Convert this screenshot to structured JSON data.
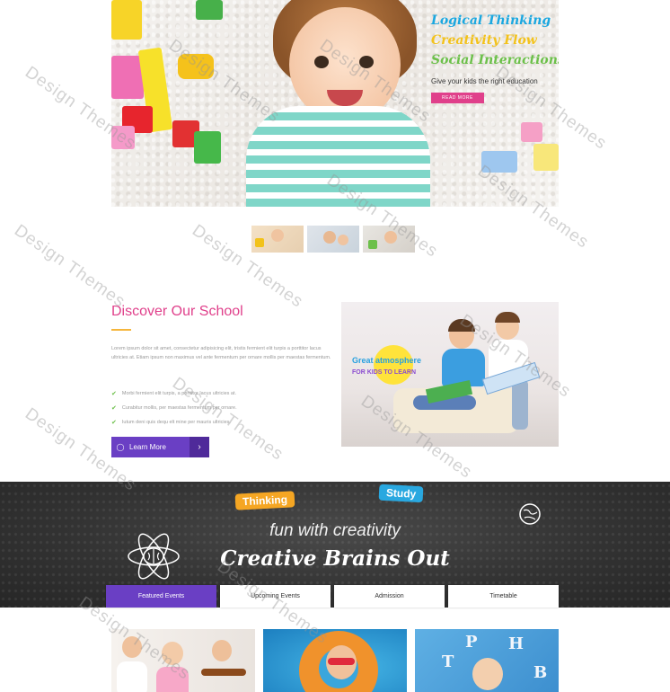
{
  "hero": {
    "line1": "Logical Thinking",
    "line2": "Creativity Flow",
    "line3": "Social Interactions",
    "tagline": "Give your kids the right education",
    "button_label": "READ MORE",
    "accent_colors": {
      "line1": "#1aa7e0",
      "line2": "#f3c21b",
      "line3": "#6cc04a",
      "button": "#e0408b"
    }
  },
  "slider": {
    "thumbnails": [
      "hero-slide-1",
      "hero-slide-2",
      "hero-slide-3"
    ]
  },
  "discover": {
    "title": "Discover Our School",
    "paragraph": "Lorem ipsum dolor sit amet, consectetur adipisicing elit, tristis fermient elit turpis a porttitor lacus ultricies at. Etiam ipsum non maximus vel ante fermentum per ornare mollis per maestas fermentum.",
    "bullets": [
      "Morbi fermient elit turpis, a porttitor lacus ultricies at.",
      "Curabitur mollis, per maestas fermentum per ornare.",
      "Iutum deni quis dequ elt mine per mauris ultricies."
    ],
    "button_label": "Learn More",
    "photo_caption_line1": "Great atmosphere",
    "photo_caption_line2": "FOR KIDS TO LEARN"
  },
  "banner": {
    "tag_left": "Thinking",
    "tag_right": "Study",
    "line1": "fun with creativity",
    "line2": "Creative Brains Out"
  },
  "tabs": [
    {
      "label": "Featured Events",
      "active": true
    },
    {
      "label": "Upcoming Events",
      "active": false
    },
    {
      "label": "Admission",
      "active": false
    },
    {
      "label": "Timetable",
      "active": false
    }
  ],
  "watermark": "Design Themes",
  "colors": {
    "primary_purple": "#6a3fc4",
    "pink": "#e0408b",
    "green": "#6cc04a",
    "chalkboard": "#333333"
  }
}
